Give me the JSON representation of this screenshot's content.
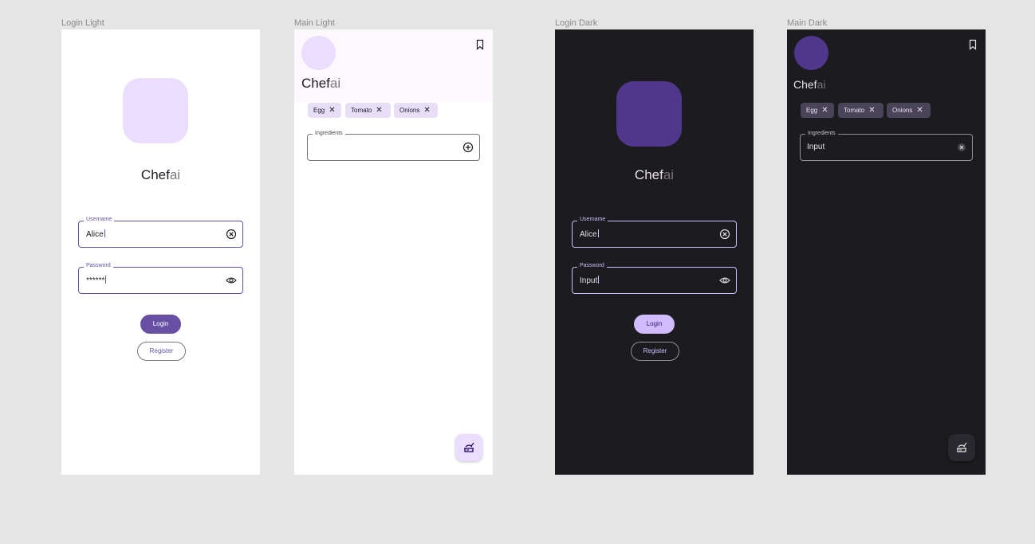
{
  "frames": {
    "login_light": {
      "label": "Login Light",
      "brand_part1": "Chef",
      "brand_part2": "ai",
      "username_label": "Username",
      "username_value": "Alice",
      "password_label": "Password",
      "password_value": "******",
      "login_label": "Login",
      "register_label": "Register"
    },
    "main_light": {
      "label": "Main Light",
      "brand_part1": "Chef",
      "brand_part2": "ai",
      "chips": [
        "Egg",
        "Tomato",
        "Onions"
      ],
      "ingredients_label": "Ingredients",
      "ingredients_value": ""
    },
    "login_dark": {
      "label": "Login Dark",
      "brand_part1": "Chef",
      "brand_part2": "ai",
      "username_label": "Username",
      "username_value": "Alice",
      "password_label": "Password",
      "password_value": "Input",
      "login_label": "Login",
      "register_label": "Register"
    },
    "main_dark": {
      "label": "Main Dark",
      "brand_part1": "Chef",
      "brand_part2": "ai",
      "chips": [
        "Egg",
        "Tomato",
        "Onions"
      ],
      "ingredients_label": "Ingredients",
      "ingredients_value": "Input"
    }
  },
  "icons": {
    "clear": "clear-circle-icon",
    "visibility": "eye-icon",
    "add": "add-circle-icon",
    "bookmark": "bookmark-icon",
    "close": "close-icon",
    "fab": "cooking-pot-icon"
  },
  "colors": {
    "primary_light": "#6750a4",
    "primary_container_light": "#eaddff",
    "primary_dark": "#d0bcff",
    "primary_container_dark": "#4f378b",
    "surface_dark": "#1c1b1f",
    "canvas": "#e5e5e5"
  }
}
